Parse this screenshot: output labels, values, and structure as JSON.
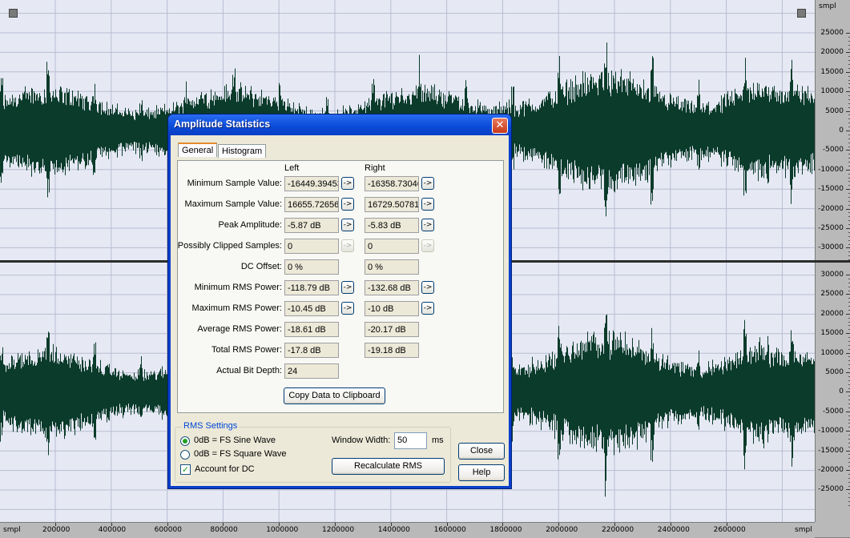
{
  "ruler": {
    "unit": "smpl",
    "top_labels": [
      "25000",
      "20000",
      "15000",
      "10000",
      "5000",
      "0",
      "-5000",
      "-10000",
      "-15000",
      "-20000",
      "-25000",
      "-30000"
    ],
    "bottom_labels": [
      "30000",
      "25000",
      "20000",
      "15000",
      "10000",
      "5000",
      "0",
      "-5000",
      "-10000",
      "-15000",
      "-20000",
      "-25000"
    ]
  },
  "timeline": {
    "unit_left": "smpl",
    "unit_right": "smpl",
    "labels": [
      "200000",
      "400000",
      "600000",
      "800000",
      "1000000",
      "1200000",
      "1400000",
      "1600000",
      "1800000",
      "2000000",
      "2200000",
      "2400000",
      "2600000"
    ]
  },
  "colors": {
    "waveform": "#0b3b2a",
    "track_bg": "#e6e9f4",
    "grid": "#b8bcd0"
  },
  "dialog": {
    "title": "Amplitude Statistics",
    "tabs": [
      "General",
      "Histogram"
    ],
    "col_left": "Left",
    "col_right": "Right",
    "rows": [
      {
        "label": "Minimum Sample Value:",
        "left": "-16449.39453",
        "right": "-16358.73046",
        "arrow": true,
        "arrow_enabled": true
      },
      {
        "label": "Maximum Sample Value:",
        "left": "16655.72656",
        "right": "16729.50781",
        "arrow": true,
        "arrow_enabled": true
      },
      {
        "label": "Peak Amplitude:",
        "left": "-5.87 dB",
        "right": "-5.83 dB",
        "arrow": true,
        "arrow_enabled": true
      },
      {
        "label": "Possibly Clipped Samples:",
        "left": "0",
        "right": "0",
        "arrow": true,
        "arrow_enabled": false
      },
      {
        "label": "DC Offset:",
        "left": "0 %",
        "right": "0 %",
        "arrow": false
      },
      {
        "label": "Minimum RMS Power:",
        "left": "-118.79 dB",
        "right": "-132.68 dB",
        "arrow": true,
        "arrow_enabled": true
      },
      {
        "label": "Maximum RMS Power:",
        "left": "-10.45 dB",
        "right": "-10 dB",
        "arrow": true,
        "arrow_enabled": true
      },
      {
        "label": "Average RMS Power:",
        "left": "-18.61 dB",
        "right": "-20.17 dB",
        "arrow": false
      },
      {
        "label": "Total RMS Power:",
        "left": "-17.8 dB",
        "right": "-19.18 dB",
        "arrow": false
      },
      {
        "label": "Actual Bit Depth:",
        "left": "24",
        "right": null,
        "arrow": false
      }
    ],
    "arrow_glyph": "->",
    "copy_button": "Copy Data to Clipboard",
    "rms_settings": {
      "title": "RMS Settings",
      "option_sine": "0dB = FS Sine Wave",
      "option_square": "0dB = FS Square Wave",
      "selected": "sine",
      "account_dc_label": "Account for DC",
      "account_dc_checked": true,
      "window_width_label": "Window Width:",
      "window_width_value": "50",
      "window_width_unit": "ms",
      "recalc_button": "Recalculate RMS"
    },
    "close_button": "Close",
    "help_button": "Help",
    "close_icon": "close-x-icon"
  }
}
